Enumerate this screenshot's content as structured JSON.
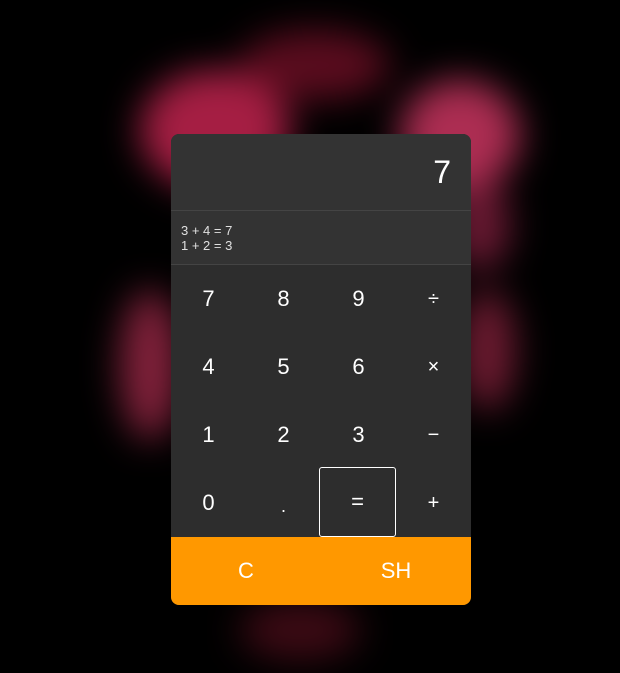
{
  "display": {
    "value": "7"
  },
  "history": [
    "3 + 4 = 7",
    "1 + 2 = 3"
  ],
  "keys": {
    "rows": [
      [
        {
          "label": "7",
          "name": "key-7"
        },
        {
          "label": "8",
          "name": "key-8"
        },
        {
          "label": "9",
          "name": "key-9"
        },
        {
          "label": "÷",
          "name": "key-divide"
        }
      ],
      [
        {
          "label": "4",
          "name": "key-4"
        },
        {
          "label": "5",
          "name": "key-5"
        },
        {
          "label": "6",
          "name": "key-6"
        },
        {
          "label": "×",
          "name": "key-multiply"
        }
      ],
      [
        {
          "label": "1",
          "name": "key-1"
        },
        {
          "label": "2",
          "name": "key-2"
        },
        {
          "label": "3",
          "name": "key-3"
        },
        {
          "label": "−",
          "name": "key-subtract"
        }
      ],
      [
        {
          "label": "0",
          "name": "key-0"
        },
        {
          "label": ".",
          "name": "key-decimal"
        },
        {
          "label": "=",
          "name": "key-equals"
        },
        {
          "label": "+",
          "name": "key-add"
        }
      ]
    ]
  },
  "bottom": {
    "clear_label": "C",
    "sh_label": "SH"
  },
  "colors": {
    "background": "#000000",
    "panel": "#2d2d2d",
    "display": "#333333",
    "accent": "#ff9800",
    "glow": "#e0306a"
  }
}
